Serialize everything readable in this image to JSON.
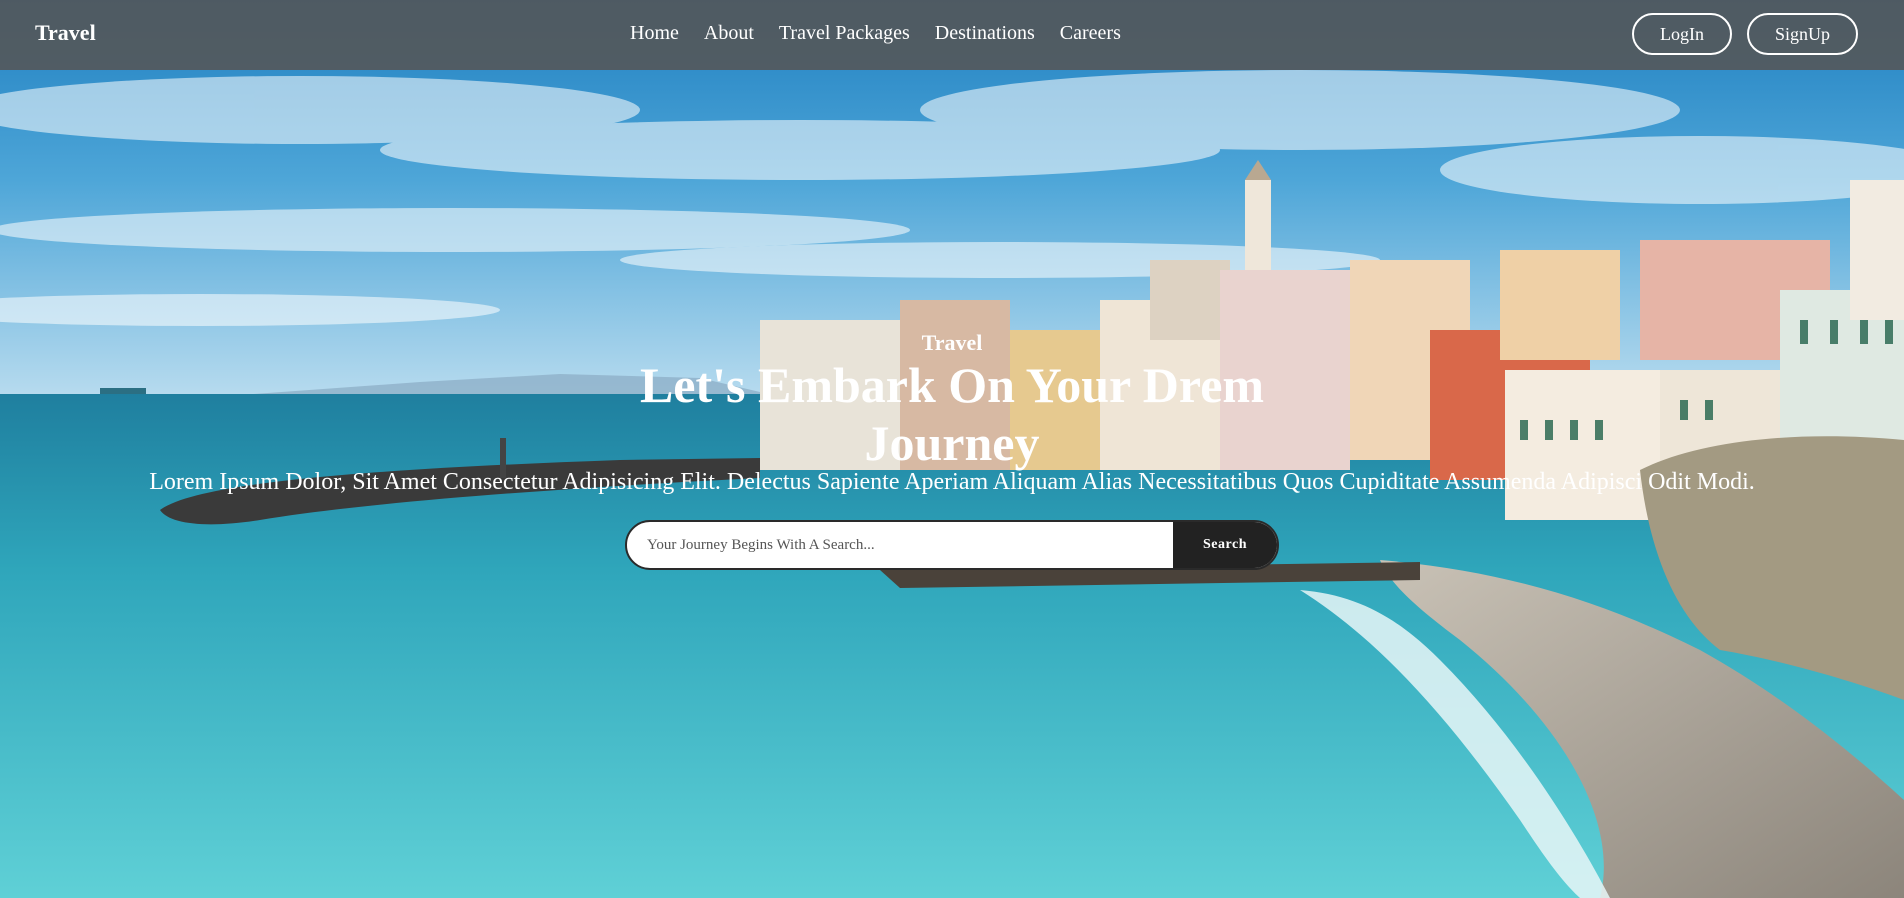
{
  "navbar": {
    "brand": "Travel",
    "links": [
      "Home",
      "About",
      "Travel Packages",
      "Destinations",
      "Careers"
    ],
    "login_label": "LogIn",
    "signup_label": "SignUp"
  },
  "hero": {
    "eyebrow": "Travel",
    "headline": "Let's Embark On Your Drem Journey",
    "lede": "Lorem Ipsum Dolor, Sit Amet Consectetur Adipisicing Elit. Delectus Sapiente Aperiam Aliquam Alias Necessitatibus Quos Cupiditate Assumenda Adipisci Odit Modi.",
    "search": {
      "placeholder": "Your Journey Begins With A Search...",
      "button_label": "Search"
    }
  },
  "colors": {
    "navbar_bg": "#555555",
    "search_button_bg": "#222222",
    "sea": "#3bb3c4",
    "sky": "#2f8fc8"
  }
}
